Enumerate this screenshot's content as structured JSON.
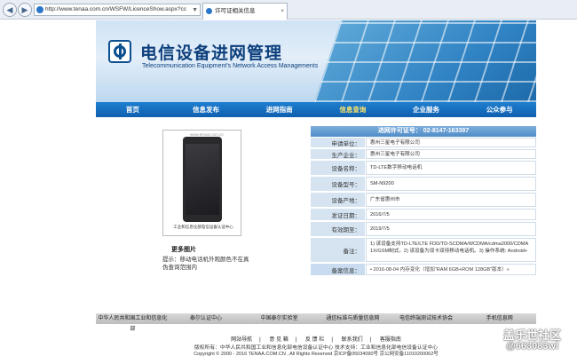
{
  "browser": {
    "url": "http://www.tenaa.com.cn/WSFW/LicenceShow.aspx?cc",
    "tab_title": "许可证相关信息",
    "back_glyph": "◀",
    "forward_glyph": "▶",
    "go_glyph": "▼",
    "close_glyph": "×"
  },
  "banner": {
    "title_cn": "电信设备进网管理",
    "title_en": "Telecommunication Equipment's Network Access Managements"
  },
  "nav": {
    "items": [
      "首页",
      "信息发布",
      "进网指南",
      "信息查询",
      "企业服务",
      "公众参与"
    ],
    "active_index": 3
  },
  "product": {
    "photo_watermark_top": "www.tenaa.com.cn",
    "photo_watermark": "工业和信息化部电信设备认证中心",
    "caption_title": "更多图片",
    "caption_text": "提示：移动电话机外观颜色不在真伪查询范围内"
  },
  "license": {
    "header": "进网许可证号：  02-8147-163397",
    "rows": [
      {
        "key": "申请单位：",
        "value": "惠州三星电子有限公司"
      },
      {
        "key": "生产企业：",
        "value": "惠州三星电子有限公司"
      },
      {
        "key": "设备名称：",
        "value": "TD-LTE数字移动电话机"
      },
      {
        "key": "设备型号：",
        "value": "SM-N9200"
      },
      {
        "key": "设备产地：",
        "value": "广东省惠州市"
      },
      {
        "key": "发证日期：",
        "value": "2016/7/5"
      },
      {
        "key": "有效期至：",
        "value": "2019/7/5"
      },
      {
        "key": "备注：",
        "value": "1) 该设备支持TD-LTE/LTE FDD/TD-SCDMA/WCDMA/cdma2000/CDMA 1X/GSM制式。2) 该设备为双卡双待移动电话机。3) 操作系统: Android+"
      },
      {
        "key": "备案信息：",
        "value": "• 2016-08-04  内存变化（增加“RAM 6GB+ROM 128GB”版本）»"
      }
    ]
  },
  "footer": {
    "bar_items": [
      "中华人民共和国工业和信息化部",
      "泰尔认证中心",
      "中国泰尔实验室",
      "通信标准与质量信息网",
      "电信终端测试技术协会",
      "手机信息网"
    ],
    "links": [
      "网站导航",
      "意 见 箱",
      "反 馈 栏",
      "联系我们",
      "客服指南"
    ],
    "copy1": "版权所有：中华人民共和国工业和信息化部电信设备认证中心     技术支持：工业和信息化部电信设备认证中心",
    "copy2": "Copyright © 2000 - 2016 TENAA.COM.CN , All Rights Reserved     京ICP备05034090号   京公网安备11010200062号"
  },
  "watermark": {
    "site": "盖乐世社区",
    "user": "@663083wl"
  }
}
